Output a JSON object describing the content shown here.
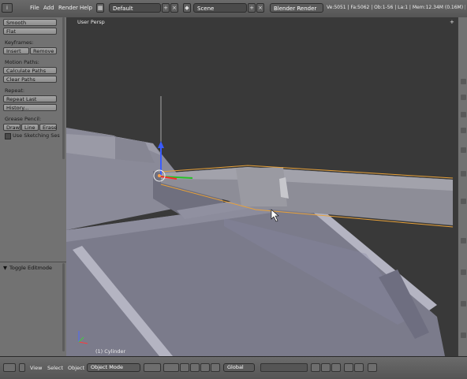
{
  "topbar": {
    "menus": [
      "File",
      "Add",
      "Render",
      "Help"
    ],
    "screen_layout": "Default",
    "scene": "Scene",
    "render_engine": "Blender Render",
    "stats": "Ve:5051 | Fa:5062 | Ob:1-56 | La:1 | Mem:12.34M (0.16M) | C"
  },
  "shelf": {
    "shading_buttons": [
      "Smooth",
      "Flat"
    ],
    "keyframes_label": "Keyframes:",
    "keyframe_buttons": [
      "Insert",
      "Remove"
    ],
    "motion_paths_label": "Motion Paths:",
    "motion_paths_buttons": [
      "Calculate Paths",
      "Clear Paths"
    ],
    "repeat_label": "Repeat:",
    "repeat_buttons": [
      "Repeat Last",
      "History..."
    ],
    "grease_pencil_label": "Grease Pencil:",
    "grease_buttons": [
      "Draw",
      "Line",
      "Erase"
    ],
    "sketch_checkbox": "Use Sketching Sessio",
    "operator_panel": "Toggle Editmode"
  },
  "viewport": {
    "view_name": "User Persp",
    "object_name": "(1) Cylinder"
  },
  "bottombar": {
    "menus": [
      "View",
      "Select",
      "Object"
    ],
    "mode": "Object Mode",
    "orientation": "Global"
  }
}
